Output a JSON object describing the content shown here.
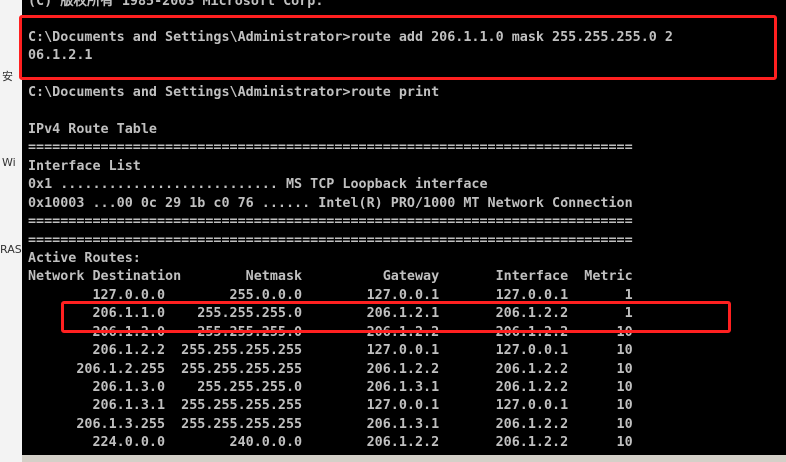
{
  "left_fragments": [
    "安",
    "Wi",
    "RAS"
  ],
  "console_lines": [
    "(C) 版权所有 1985-2003 Microsoft Corp.",
    "",
    "C:\\Documents and Settings\\Administrator>route add 206.1.1.0 mask 255.255.255.0 2",
    "06.1.2.1",
    "",
    "C:\\Documents and Settings\\Administrator>route print",
    "",
    "IPv4 Route Table",
    "===========================================================================",
    "Interface List",
    "0x1 ........................... MS TCP Loopback interface",
    "0x10003 ...00 0c 29 1b c0 76 ...... Intel(R) PRO/1000 MT Network Connection",
    "===========================================================================",
    "===========================================================================",
    "Active Routes:",
    "Network Destination        Netmask          Gateway       Interface  Metric",
    "        127.0.0.0        255.0.0.0        127.0.0.1       127.0.0.1       1",
    "        206.1.1.0    255.255.255.0        206.1.2.1       206.1.2.2       1",
    "        206.1.2.0    255.255.255.0        206.1.2.2       206.1.2.2      10",
    "        206.1.2.2  255.255.255.255        127.0.0.1       127.0.0.1      10",
    "      206.1.2.255  255.255.255.255        206.1.2.2       206.1.2.2      10",
    "        206.1.3.0    255.255.255.0        206.1.3.1       206.1.2.2      10",
    "        206.1.3.1  255.255.255.255        127.0.0.1       127.0.0.1      10",
    "      206.1.3.255  255.255.255.255        206.1.3.1       206.1.2.2      10",
    "        224.0.0.0        240.0.0.0        206.1.2.2       206.1.2.2      10"
  ]
}
